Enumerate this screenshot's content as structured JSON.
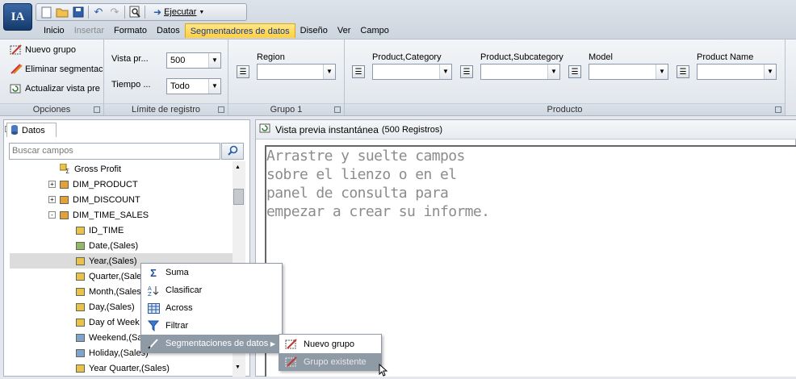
{
  "app": {
    "logo": "IA"
  },
  "quickaccess": {
    "run_label": "Ejecutar"
  },
  "menu_tabs": [
    {
      "label": "Inicio",
      "state": "normal"
    },
    {
      "label": "Insertar",
      "state": "disabled"
    },
    {
      "label": "Formato",
      "state": "normal"
    },
    {
      "label": "Datos",
      "state": "normal"
    },
    {
      "label": "Segmentadores de datos",
      "state": "active"
    },
    {
      "label": "Diseño",
      "state": "normal"
    },
    {
      "label": "Ver",
      "state": "normal"
    },
    {
      "label": "Campo",
      "state": "normal"
    }
  ],
  "ribbon": {
    "opciones": {
      "group_label": "Opciones",
      "nuevo_grupo": "Nuevo grupo",
      "eliminar": "Eliminar segmentac",
      "actualizar": "Actualizar vista pre"
    },
    "limite": {
      "group_label": "Límite de registro",
      "vista_label": "Vista pr...",
      "vista_value": "500",
      "tiempo_label": "Tiempo ...",
      "tiempo_value": "Todo"
    },
    "grupo1": {
      "group_label": "Grupo 1",
      "region_label": "Region"
    },
    "producto": {
      "group_label": "Producto",
      "category_label": "Product,Category",
      "subcategory_label": "Product,Subcategory",
      "model_label": "Model",
      "name_label": "Product Name"
    }
  },
  "left_panel": {
    "title": "Datos",
    "search_placeholder": "Buscar campos",
    "tree": [
      {
        "label": "Gross Profit",
        "icon": "gross-profit",
        "indent": 2
      },
      {
        "label": "DIM_PRODUCT",
        "icon": "dimension",
        "indent": 1,
        "expander": "+"
      },
      {
        "label": "DIM_DISCOUNT",
        "icon": "dimension",
        "indent": 1,
        "expander": "+"
      },
      {
        "label": "DIM_TIME_SALES",
        "icon": "dimension",
        "indent": 1,
        "expander": "-"
      },
      {
        "label": "ID_TIME",
        "icon": "field-yellow",
        "indent": 2
      },
      {
        "label": "Date,(Sales)",
        "icon": "field-green",
        "indent": 2
      },
      {
        "label": "Year,(Sales)",
        "icon": "field-yellow",
        "indent": 2,
        "highlighted": true
      },
      {
        "label": "Quarter,(Sales)",
        "icon": "field-yellow",
        "indent": 2
      },
      {
        "label": "Month,(Sales)",
        "icon": "field-yellow",
        "indent": 2
      },
      {
        "label": "Day,(Sales)",
        "icon": "field-yellow",
        "indent": 2
      },
      {
        "label": "Day of Week",
        "icon": "field-yellow",
        "indent": 2
      },
      {
        "label": "Weekend,(Sales)",
        "icon": "field-blue",
        "indent": 2
      },
      {
        "label": "Holiday,(Sales)",
        "icon": "field-blue",
        "indent": 2
      },
      {
        "label": "Year Quarter,(Sales)",
        "icon": "field-yellow",
        "indent": 2
      }
    ]
  },
  "right_panel": {
    "title": "Vista previa instantánea",
    "record_count": "(500 Registros)",
    "hint": "Arrastre y suelte campos sobre el lienzo o en el panel de consulta para empezar a crear su informe."
  },
  "context_menu": {
    "items": [
      {
        "label": "Suma",
        "icon": "sigma-icon"
      },
      {
        "label": "Clasificar",
        "icon": "sort-az-icon"
      },
      {
        "label": "Across",
        "icon": "grid-icon"
      },
      {
        "label": "Filtrar",
        "icon": "funnel-icon"
      },
      {
        "label": "Segmentaciones de datos",
        "icon": "slicer-pen-icon",
        "selected": true,
        "has_submenu": true
      }
    ],
    "submenu": [
      {
        "label": "Nuevo grupo"
      },
      {
        "label": "Grupo existente",
        "selected": true
      }
    ]
  }
}
